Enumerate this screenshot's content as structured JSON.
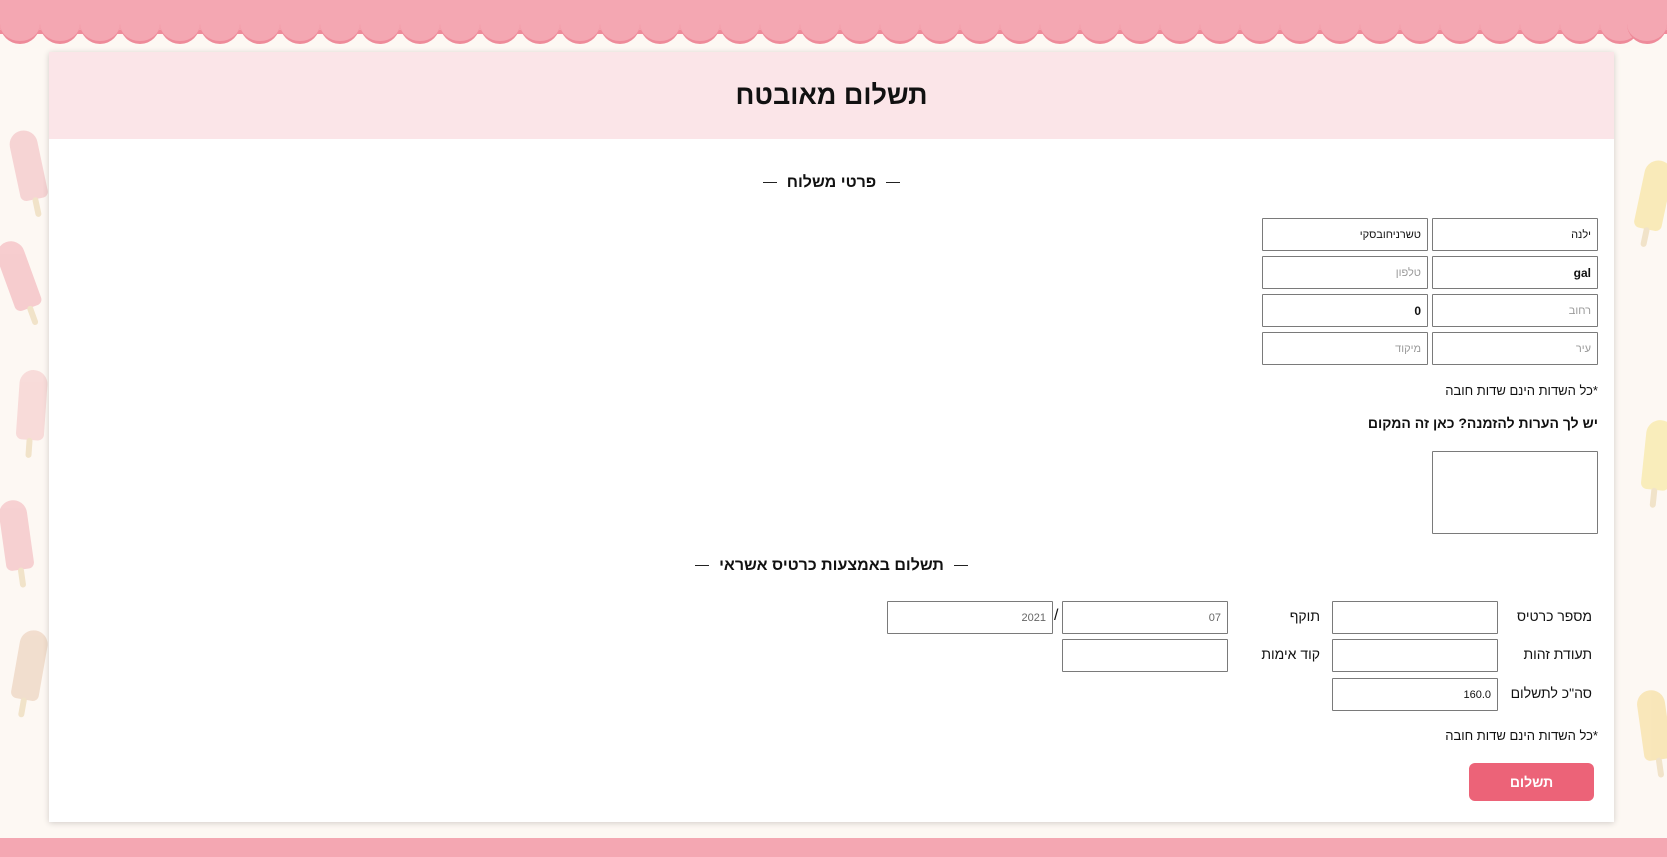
{
  "colors": {
    "accent": "#ec6378",
    "header_bg": "#fbe5e8",
    "scallop": "#f4a7b2",
    "page_bg": "#fdf8f3"
  },
  "page": {
    "title": "תשלום מאובטח"
  },
  "shipping": {
    "section_title": "פרטי משלוח",
    "first_name": {
      "value": "ילנה",
      "placeholder": ""
    },
    "last_name": {
      "value": "טשרניחובסקי",
      "placeholder": ""
    },
    "email": {
      "value": "gal",
      "placeholder": ""
    },
    "phone": {
      "value": "",
      "placeholder": "טלפון"
    },
    "street": {
      "value": "",
      "placeholder": "רחוב"
    },
    "house_number": {
      "value": "0",
      "placeholder": ""
    },
    "city": {
      "value": "",
      "placeholder": "עיר"
    },
    "zip": {
      "value": "",
      "placeholder": "מיקוד"
    },
    "required_note": "*כל השדות הינם שדות חובה",
    "comments_label": "יש לך הערות להזמנה? כאן זה המקום",
    "comments_value": ""
  },
  "payment": {
    "section_title": "תשלום באמצעות כרטיס אשראי",
    "card_number_label": "מספר כרטיס",
    "card_number_value": "",
    "expiry_label": "תוקף",
    "expiry_month": "07",
    "expiry_separator": "/",
    "expiry_year": "2021",
    "id_label": "תעודת זהות",
    "id_value": "",
    "cvv_label": "קוד אימות",
    "cvv_value": "",
    "total_label": "סה\"כ לתשלום",
    "total_value": "160.0",
    "required_note": "*כל השדות הינם שדות חובה",
    "submit_label": "תשלום"
  }
}
